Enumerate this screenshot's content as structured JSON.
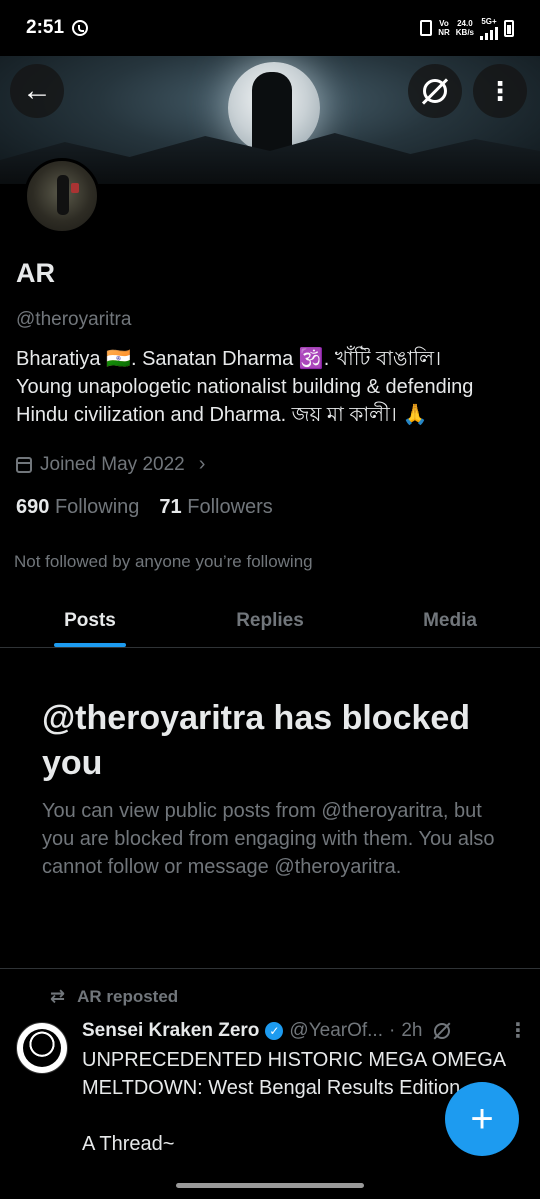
{
  "status_bar": {
    "time": "2:51",
    "network_top": "Vo",
    "network_bottom": "NR",
    "speed_top": "24.0",
    "speed_bottom": "KB/s",
    "signal_label": "5G+"
  },
  "profile": {
    "name": "AR",
    "handle": "@theroyaritra",
    "bio_line1": "Bharatiya 🇮🇳. Sanatan Dharma 🕉️. খাঁটি বাঙালি।",
    "bio_line2": "Young unapologetic nationalist building & defending Hindu civilization and Dharma. জয় মা কালী। 🙏",
    "joined": "Joined May 2022",
    "following_count": "690",
    "following_label": "Following",
    "followers_count": "71",
    "followers_label": "Followers",
    "not_followed_note": "Not followed by anyone you’re following"
  },
  "tabs": [
    {
      "label": "Posts"
    },
    {
      "label": "Replies"
    },
    {
      "label": "Media"
    }
  ],
  "blocked": {
    "title": "@theroyaritra has blocked you",
    "description": "You can view public posts from @theroyaritra, but you are blocked from engaging with them. You also cannot follow or message @theroyaritra."
  },
  "post": {
    "repost_label": "AR reposted",
    "author": "Sensei Kraken Zero",
    "handle": "@YearOf...",
    "separator": "·",
    "time": "2h",
    "text": "UNPRECEDENTED HISTORIC MEGA OMEGA MELTDOWN: West Bengal Results Edition\n\nA Thread~"
  },
  "colors": {
    "accent": "#1d9bf0",
    "background": "#000000",
    "muted_text": "#71767b",
    "primary_text": "#e7e9ea"
  }
}
